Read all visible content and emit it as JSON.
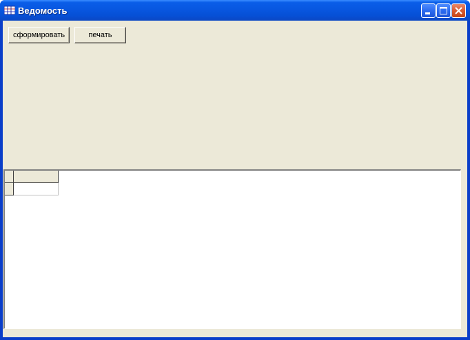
{
  "window": {
    "title": "Ведомость",
    "app_icon": "grid-app-icon"
  },
  "title_buttons": {
    "minimize": "minimize-icon",
    "maximize": "maximize-icon",
    "close": "close-icon"
  },
  "toolbar": {
    "form_label": "сформировать",
    "print_label": "печать"
  },
  "grid": {
    "columns": [
      ""
    ],
    "rows": [
      [
        ""
      ]
    ]
  },
  "colors": {
    "titlebar": "#0857e0",
    "client_bg": "#ece9d8",
    "close_button": "#d85a30"
  }
}
